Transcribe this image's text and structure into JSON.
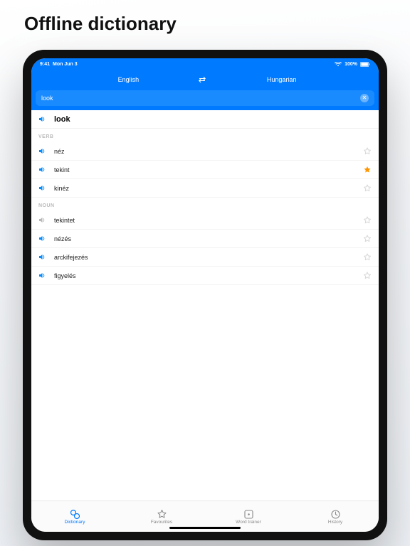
{
  "page": {
    "title": "Offline dictionary"
  },
  "status": {
    "time": "9:41",
    "date": "Mon Jun 3",
    "battery": "100%"
  },
  "header": {
    "source_lang": "English",
    "target_lang": "Hungarian",
    "search_value": "look"
  },
  "headword": {
    "text": "look"
  },
  "sections": [
    {
      "label": "VERB",
      "entries": [
        {
          "word": "néz",
          "favourite": false,
          "muted": false
        },
        {
          "word": "tekint",
          "favourite": true,
          "muted": false
        },
        {
          "word": "kinéz",
          "favourite": false,
          "muted": false
        }
      ]
    },
    {
      "label": "NOUN",
      "entries": [
        {
          "word": "tekintet",
          "favourite": false,
          "muted": true
        },
        {
          "word": "nézés",
          "favourite": false,
          "muted": false
        },
        {
          "word": "arckifejezés",
          "favourite": false,
          "muted": false
        },
        {
          "word": "figyelés",
          "favourite": false,
          "muted": false
        }
      ]
    }
  ],
  "tabs": [
    {
      "label": "Dictionary",
      "active": true
    },
    {
      "label": "Favourites",
      "active": false
    },
    {
      "label": "Word trainer",
      "active": false
    },
    {
      "label": "History",
      "active": false
    }
  ]
}
